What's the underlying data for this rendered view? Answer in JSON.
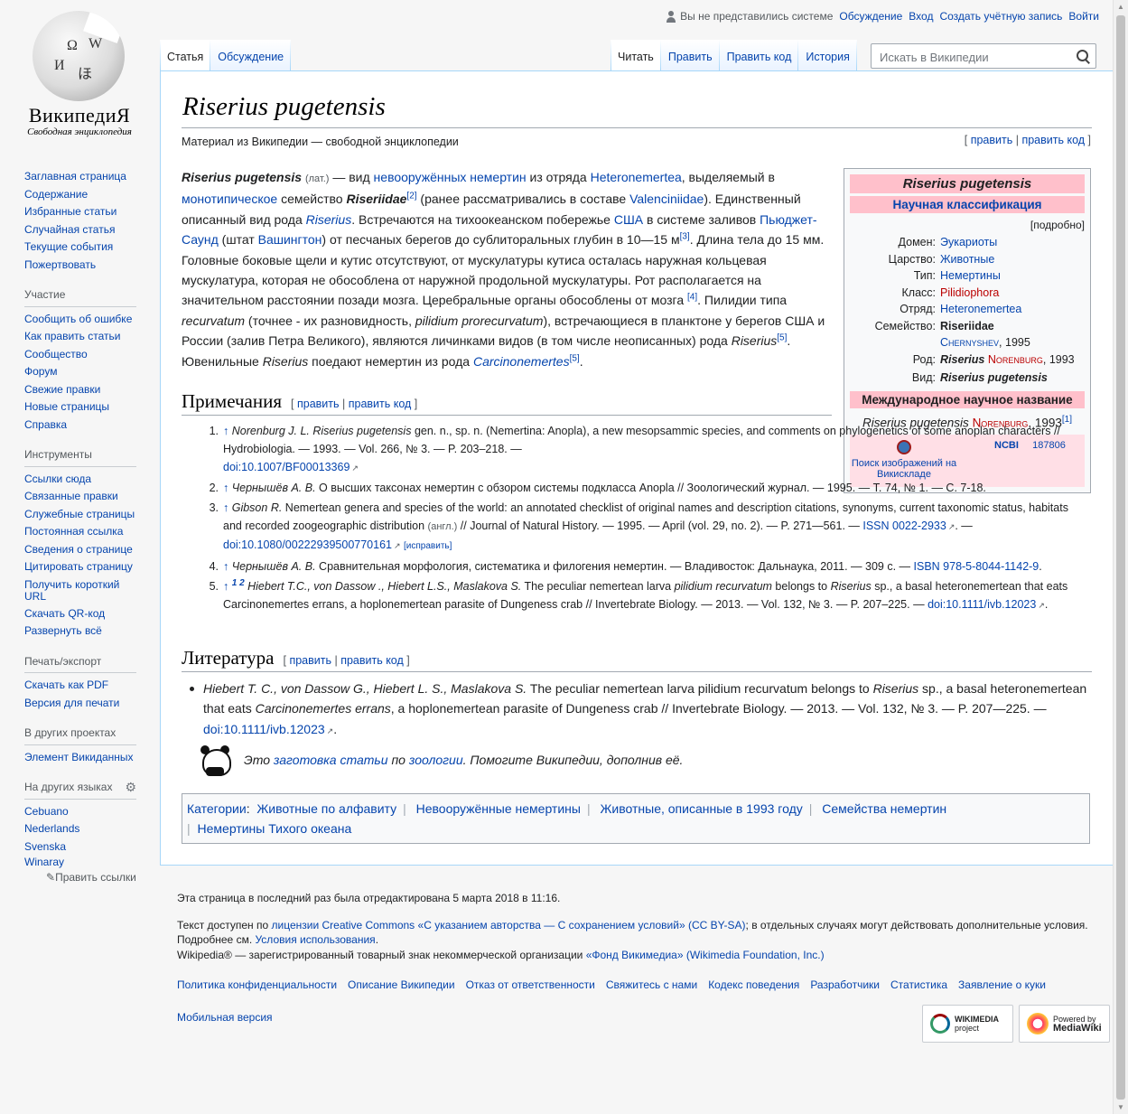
{
  "header": {
    "personal": {
      "anon": "Вы не представились системе",
      "talk": "Обсуждение",
      "login": "Вход",
      "create": "Создать учётную запись",
      "logout": "Войти"
    },
    "tabs_left": [
      "Статья",
      "Обсуждение"
    ],
    "tabs_right": [
      "Читать",
      "Править",
      "Править код",
      "История"
    ],
    "search_placeholder": "Искать в Википедии"
  },
  "logo": {
    "wordmark": "ВикипедиЯ",
    "tagline": "Свободная энциклопедия"
  },
  "sidebar": {
    "nav": [
      "Заглавная страница",
      "Содержание",
      "Избранные статьи",
      "Случайная статья",
      "Текущие события",
      "Пожертвовать"
    ],
    "participation": {
      "title": "Участие",
      "items": [
        "Сообщить об ошибке",
        "Как править статьи",
        "Сообщество",
        "Форум",
        "Свежие правки",
        "Новые страницы",
        "Справка"
      ]
    },
    "tools": {
      "title": "Инструменты",
      "items": [
        "Ссылки сюда",
        "Связанные правки",
        "Служебные страницы",
        "Постоянная ссылка",
        "Сведения о странице",
        "Цитировать страницу",
        "Получить короткий URL",
        "Скачать QR-код",
        "Развернуть всё"
      ]
    },
    "print": {
      "title": "Печать/экспорт",
      "items": [
        "Скачать как PDF",
        "Версия для печати"
      ]
    },
    "projects": {
      "title": "В других проектах",
      "items": [
        "Элемент Викиданных"
      ]
    },
    "languages": {
      "title": "На других языках",
      "items": [
        "Cebuano",
        "Nederlands",
        "Svenska",
        "Winaray"
      ],
      "edit": "Править ссылки"
    }
  },
  "article": {
    "title": "Riserius pugetensis",
    "site_sub": "Материал из Википедии — свободной энциклопедии",
    "edit": "править",
    "edit_code": "править код",
    "lead": {
      "t1": "Riserius pugetensis",
      "t2": "(лат.)",
      "t3": " — вид ",
      "l1": "невооружённых немертин",
      "t4": " из отряда ",
      "l2": "Heteronemertea",
      "t5": ", выделяемый в ",
      "l3": "монотипическое",
      "t6": " семейство ",
      "t7": "Riseriidae",
      "r1": "[2]",
      "t8": " (ранее рассматривались в составе ",
      "l4": "Valenciniidae",
      "t9": "). Единственный описанный вид рода ",
      "l5": "Riserius",
      "t10": ". Встречаются на тихоокеанском побережье ",
      "l6": "США",
      "t11": " в системе заливов ",
      "l7": "Пьюджет-Саунд",
      "t12": " (штат ",
      "l8": "Вашингтон",
      "t13": ") от песчаных берегов до сублиторальных глубин в 10—15 м",
      "r3": "[3]",
      "t14": ". Длина тела до 15 мм. Головные боковые щели и кутис отсутствуют, от мускулатуры кутиса осталась наружная кольцевая мускулатура, которая не обособлена от наружной продольной мускулатуры. Рот располагается на значительном расстоянии позади мозга. Церебральные органы обособлены от мозга ",
      "r4": "[4]",
      "t15": ". Пилидии типа ",
      "t16": "recurvatum",
      "t17": " (точнее - их разновидность, ",
      "t18": "pilidium prorecurvatum",
      "t19": "), встречающиеся в планктоне у берегов США и России (залив Петра Великого), являются личинками видов (в том числе неописанных) рода ",
      "t20": "Riserius",
      "r5": "[5]",
      "t21": ". Ювенильные ",
      "t22": "Riserius",
      "t23": " поедают немертин из рода ",
      "l9": "Carcinonemertes",
      "r5b": "[5]",
      "t24": "."
    }
  },
  "infobox": {
    "title": "Riserius pugetensis",
    "classification": "Научная классификация",
    "detail": "[подробно]",
    "rows": [
      {
        "label": "Домен:",
        "value": "Эукариоты"
      },
      {
        "label": "Царство:",
        "value": "Животные"
      },
      {
        "label": "Тип:",
        "value": "Немертины"
      },
      {
        "label": "Класс:",
        "value": "Pilidiophora"
      },
      {
        "label": "Отряд:",
        "value": "Heteronemertea"
      }
    ],
    "family_label": "Семейство:",
    "family_value": "Riseriidae",
    "family_author": "Chernyshev",
    "family_year": ", 1995",
    "genus_label": "Род:",
    "genus_value": "Riserius",
    "genus_author": "Norenburg",
    "genus_year": ", 1993",
    "species_label": "Вид:",
    "species_value": "Riserius pugetensis",
    "intl_head": "Международное научное название",
    "intl_name": "Riserius pugetensis",
    "intl_author": "Norenburg",
    "intl_year": ", 1993",
    "intl_ref": "[1]",
    "commons": "Поиск изображений на Викискладе",
    "ncbi": "NCBI",
    "ncbi_id": "187806"
  },
  "notes": {
    "title": "Примечания",
    "items": [
      {
        "num": "1.",
        "arrow": "↑",
        "a": "Norenburg J. L.",
        "b": " Riserius pugetensis",
        "c": " gen. n., sp. n. (Nemertina: Anopla), a new mesopsammic species, and comments on phylogenetics of some anoplan characters // Hydrobiologia. — 1993. — Vol. 266, № 3. — P. 203–218. — ",
        "doi": "doi:10.1007/BF00013369"
      },
      {
        "num": "2.",
        "arrow": "↑",
        "a": "Чернышёв А. В.",
        "c": " О высших таксонах немертин с обзором системы подкласса Anopla // Зоологический журнал. — 1995. — Т. 74, № 1. — С. 7-18."
      },
      {
        "num": "3.",
        "arrow": "↑",
        "a": "Gibson R.",
        "c": " Nemertean genera and species of the world: an annotated checklist of original names and description citations, synonyms, current taxonomic status, habitats and recorded zoogeographic distribution ",
        "lang": "(англ.)",
        "d": " // Journal of Natural History. — 1995. — April (vol. 29, no. 2). — P. 271—561. — ",
        "issn": "ISSN 0022-2933",
        "e": ". — ",
        "doi": "doi:10.1080/00222939500770161",
        "fix": "[исправить]"
      },
      {
        "num": "4.",
        "arrow": "↑",
        "a": "Чернышёв А. В.",
        "c": " Сравнительная морфология, систематика и филогения немертин. — Владивосток: Дальнаука, 2011. — 309 с. — ",
        "isbn": "ISBN 978-5-8044-1142-9",
        "e": "."
      },
      {
        "num": "5.",
        "arrow": "↑",
        "sup": "1 2",
        "a": "Hiebert T.C., von Dassow ., Hiebert L.S., Maslakova S.",
        "c": " The peculiar nemertean larva ",
        "i1": "pilidium recurvatum",
        "c2": " belongs to ",
        "i2": "Riserius",
        "c3": " sp., a basal heteronemertean that eats Carcinonemertes errans, a hoplonemertean parasite of Dungeness crab // Invertebrate Biology. — 2013. — Vol. 132, № 3. — P. 207–225. — ",
        "doi": "doi:10.1111/ivb.12023",
        "e": "."
      }
    ]
  },
  "literature": {
    "title": "Литература",
    "authors": "Hiebert T. C., von Dassow G., Hiebert L. S., Maslakova S.",
    "t1": " The peculiar nemertean larva pilidium recurvatum belongs to ",
    "i1": "Riserius",
    "t2": " sp., a basal heteronemertean that eats ",
    "i2": "Carcinonemertes errans",
    "t3": ", a hoplonemertean parasite of Dungeness crab // Invertebrate Biology. — 2013. — Vol. 132, № 3. — P. 207—225. — ",
    "doi": "doi:10.1111/ivb.12023",
    "end": "."
  },
  "stub": {
    "t1": "Это ",
    "l1": "заготовка статьи",
    "t2": " по ",
    "l2": "зоологии",
    "t3": ". Помогите Википедии, дополнив её."
  },
  "categories": {
    "label": "Категории",
    "items": [
      "Животные по алфавиту",
      "Невооружённые немертины",
      "Животные, описанные в 1993 году",
      "Семейства немертин",
      "Немертины Тихого океана"
    ]
  },
  "footer": {
    "lastmod": "Эта страница в последний раз была отредактирована 5 марта 2018 в 11:16.",
    "license_pre": "Текст доступен по ",
    "license_link": "лицензии Creative Commons «С указанием авторства — С сохранением условий» (CC BY-SA)",
    "license_post": "; в отдельных случаях могут действовать дополнительные условия.",
    "terms_pre": "Подробнее см. ",
    "terms_link": "Условия использования",
    "terms_post": ".",
    "trademark_pre": "Wikipedia® — зарегистрированный товарный знак некоммерческой организации ",
    "trademark_link": "«Фонд Викимедиа» (Wikimedia Foundation, Inc.)",
    "links": [
      "Политика конфиденциальности",
      "Описание Википедии",
      "Отказ от ответственности",
      "Свяжитесь с нами",
      "Кодекс поведения",
      "Разработчики",
      "Статистика",
      "Заявление о куки"
    ],
    "mobile": "Мобильная версия",
    "badge1_a": "WIKIMEDIA",
    "badge1_b": "project",
    "badge2_a": "Powered by",
    "badge2_b": "MediaWiki"
  }
}
